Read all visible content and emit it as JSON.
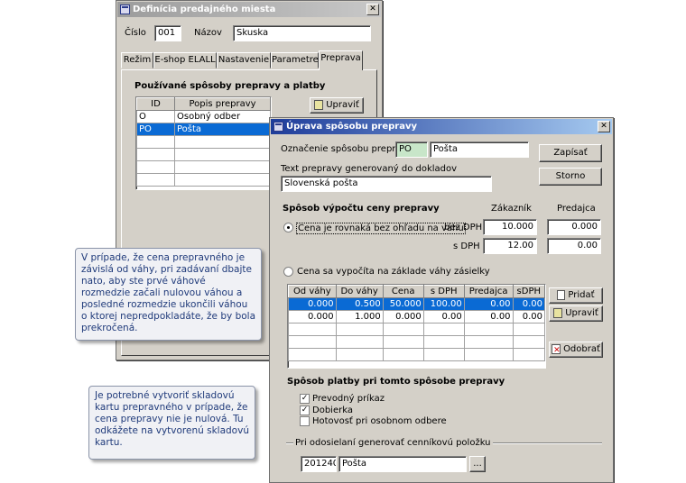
{
  "back_window": {
    "title": "Definícia predajného miesta",
    "cislo_label": "Číslo",
    "cislo_value": "001",
    "nazov_label": "Názov",
    "nazov_value": "Skuska",
    "tabs": [
      {
        "label": "Režim"
      },
      {
        "label": "E-shop ELALL"
      },
      {
        "label": "Nastavenie"
      },
      {
        "label": "Parametre"
      },
      {
        "label": "Preprava"
      }
    ],
    "section_title": "Používané spôsoby prepravy a platby",
    "edit_button": "Upraviť",
    "table_headers": [
      "ID",
      "Popis prepravy"
    ],
    "rows": [
      {
        "id": "O",
        "popis": "Osobný odber"
      },
      {
        "id": "PO",
        "popis": "Pošta"
      }
    ]
  },
  "front_window": {
    "title": "Úprava spôsobu prepravy",
    "oznacenie_label": "Označenie spôsobu prepravy",
    "oznacenie_code": "PO",
    "oznacenie_name": "Pošta",
    "zapisat": "Zapísať",
    "storno": "Storno",
    "text_label": "Text prepravy generovaný do dokladov",
    "text_value": "Slovenská pošta",
    "vypocet_title": "Spôsob výpočtu ceny prepravy",
    "col_zakaznik": "Zákazník",
    "col_predajca": "Predajca",
    "radio1": "Cena je rovnaká bez ohľadu na váhu",
    "bez_dph_label": "bez DPH",
    "s_dph_label": "s DPH",
    "zak_bez": "10.000",
    "pred_bez": "0.000",
    "zak_s": "12.00",
    "pred_s": "0.00",
    "radio2": "Cena sa vypočíta na základe váhy zásielky",
    "weight_headers": [
      "Od váhy",
      "Do váhy",
      "Cena",
      "s DPH",
      "Predajca",
      "sDPH"
    ],
    "weight_rows": [
      [
        "0.000",
        "0.500",
        "50.000",
        "100.00",
        "0.00",
        "0.00"
      ],
      [
        "0.000",
        "1.000",
        "0.000",
        "0.00",
        "0.00",
        "0.00"
      ]
    ],
    "pridat": "Pridať",
    "upravit": "Upraviť",
    "odobrat": "Odobrať",
    "platba_title": "Spôsob platby pri tomto spôsobe prepravy",
    "platby": [
      {
        "label": "Prevodný príkaz",
        "checked": "✓"
      },
      {
        "label": "Dobierka",
        "checked": "✓"
      },
      {
        "label": "Hotovosť pri osobnom odbere",
        "checked": ""
      }
    ],
    "cennik_label": "Pri odosielaní generovať cenníkovú položku",
    "cennik_code": "201240",
    "cennik_name": "Pošta",
    "browse": "..."
  },
  "callouts": {
    "weight_note": "V prípade, že cena prepravného je závislá od váhy, pri zadávaní dbajte nato, aby ste  prvé váhové rozmedzie začali nulovou váhou a posledné rozmedzie ukončili váhou o ktorej nepredpokladáte, že by bola prekročená.",
    "card_note": "Je potrebné vytvoriť skladovú kartu prepravného v prípade, že cena prepravy nie je nulová. Tu odkážete na vytvorenú skladovú kartu."
  }
}
